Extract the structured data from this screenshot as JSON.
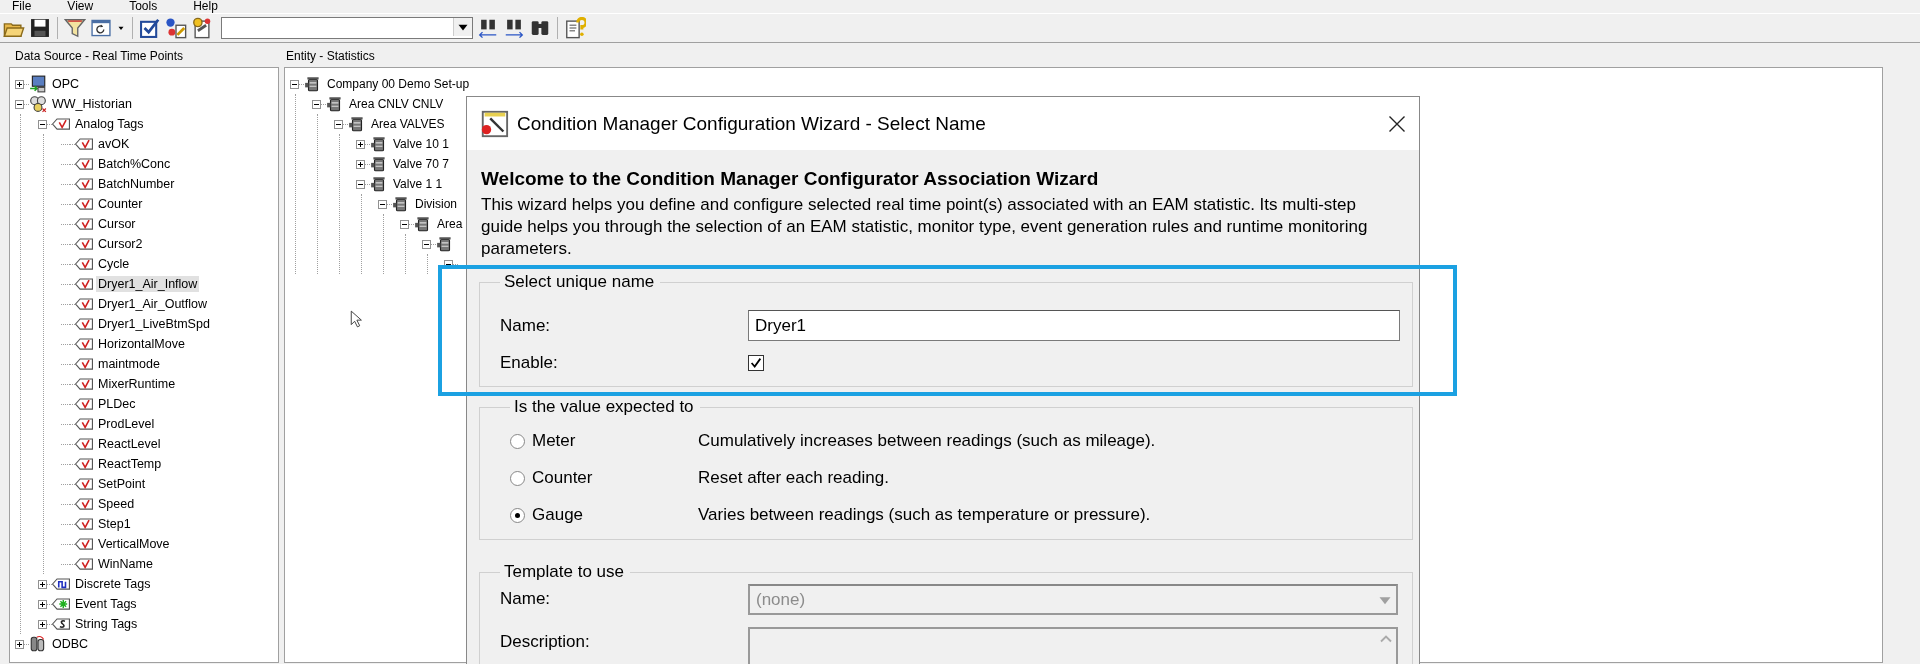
{
  "menu": [
    "File",
    "View",
    "Tools",
    "Help"
  ],
  "data_source": {
    "title": "Data Source - Real Time Points",
    "items": [
      {
        "label": "OPC",
        "kind": "opc",
        "expanded": false,
        "selected": false
      },
      {
        "label": "WW_Historian",
        "kind": "historian",
        "expanded": true,
        "selected": false,
        "children": [
          {
            "label": "Analog Tags",
            "kind": "analog",
            "expanded": true,
            "selected": false,
            "children": [
              {
                "label": "avOK",
                "kind": "analog",
                "selected": false
              },
              {
                "label": "Batch%Conc",
                "kind": "analog",
                "selected": false
              },
              {
                "label": "BatchNumber",
                "kind": "analog",
                "selected": false
              },
              {
                "label": "Counter",
                "kind": "analog",
                "selected": false
              },
              {
                "label": "Cursor",
                "kind": "analog",
                "selected": false
              },
              {
                "label": "Cursor2",
                "kind": "analog",
                "selected": false
              },
              {
                "label": "Cycle",
                "kind": "analog",
                "selected": false
              },
              {
                "label": "Dryer1_Air_Inflow",
                "kind": "analog",
                "selected": true
              },
              {
                "label": "Dryer1_Air_Outflow",
                "kind": "analog",
                "selected": false
              },
              {
                "label": "Dryer1_LiveBtmSpd",
                "kind": "analog",
                "selected": false
              },
              {
                "label": "HorizontalMove",
                "kind": "analog",
                "selected": false
              },
              {
                "label": "maintmode",
                "kind": "analog",
                "selected": false
              },
              {
                "label": "MixerRuntime",
                "kind": "analog",
                "selected": false
              },
              {
                "label": "PLDec",
                "kind": "analog",
                "selected": false
              },
              {
                "label": "ProdLevel",
                "kind": "analog",
                "selected": false
              },
              {
                "label": "ReactLevel",
                "kind": "analog",
                "selected": false
              },
              {
                "label": "ReactTemp",
                "kind": "analog",
                "selected": false
              },
              {
                "label": "SetPoint",
                "kind": "analog",
                "selected": false
              },
              {
                "label": "Speed",
                "kind": "analog",
                "selected": false
              },
              {
                "label": "Step1",
                "kind": "analog",
                "selected": false
              },
              {
                "label": "VerticalMove",
                "kind": "analog",
                "selected": false
              },
              {
                "label": "WinName",
                "kind": "analog",
                "selected": false
              }
            ]
          },
          {
            "label": "Discrete Tags",
            "kind": "discrete",
            "expanded": false,
            "selected": false
          },
          {
            "label": "Event Tags",
            "kind": "event",
            "expanded": false,
            "selected": false
          },
          {
            "label": "String Tags",
            "kind": "string",
            "expanded": false,
            "selected": false
          }
        ]
      },
      {
        "label": "ODBC",
        "kind": "odbc",
        "expanded": false,
        "selected": false
      }
    ]
  },
  "entity": {
    "title": "Entity - Statistics",
    "items": [
      {
        "label": "Company  00  Demo Set-up",
        "kind": "equipment",
        "expanded": true,
        "children": [
          {
            "label": "Area  CNLV  CNLV",
            "kind": "equipment",
            "expanded": true,
            "children": [
              {
                "label": "Area  VALVES",
                "kind": "equipment",
                "expanded": true,
                "children": [
                  {
                    "label": "Valve  10  1",
                    "kind": "equipment",
                    "expanded": false
                  },
                  {
                    "label": "Valve  70  7",
                    "kind": "equipment",
                    "expanded": false
                  },
                  {
                    "label": "Valve  1  1",
                    "kind": "equipment",
                    "expanded": true,
                    "children": [
                      {
                        "label": "Division",
                        "kind": "equipment",
                        "expanded": true,
                        "children": [
                          {
                            "label": "Area",
                            "kind": "equipment",
                            "expanded": true,
                            "children": [
                              {
                                "kind": "equipment",
                                "expanded": true,
                                "children": [
                                  {
                                    "expanded": true
                                  }
                                ]
                              }
                            ]
                          }
                        ]
                      }
                    ]
                  }
                ]
              }
            ]
          }
        ]
      }
    ]
  },
  "wizard": {
    "title": "Condition Manager Configuration Wizard - Select Name",
    "heading": "Welcome to the Condition Manager Configurator Association Wizard",
    "description": "This wizard helps you define and configure selected real time point(s) associated with an EAM statistic. Its multi-step guide helps you through the selection of an EAM statistic, monitor type, event generation rules and runtime monitoring parameters.",
    "unique_name": {
      "legend": "Select unique name",
      "name_label": "Name:",
      "name_value": "Dryer1",
      "enable_label": "Enable:",
      "enabled": true
    },
    "value_type": {
      "legend": "Is the value expected to",
      "options": [
        {
          "label": "Meter",
          "description": "Cumulatively increases between readings (such as mileage).",
          "selected": false
        },
        {
          "label": "Counter",
          "description": "Reset after each reading.",
          "selected": false
        },
        {
          "label": "Gauge",
          "description": "Varies between readings (such as temperature or pressure).",
          "selected": true
        }
      ]
    },
    "template": {
      "legend": "Template to use",
      "name_label": "Name:",
      "name_value": "(none)",
      "description_label": "Description:",
      "disabled": true
    }
  }
}
